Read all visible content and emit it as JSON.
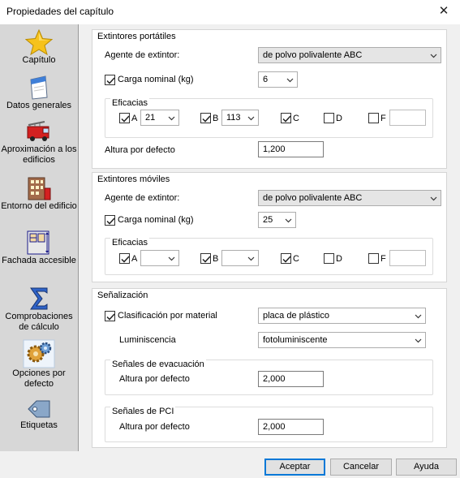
{
  "window": {
    "title": "Propiedades del capítulo",
    "close_glyph": "✕"
  },
  "sidebar": {
    "items": [
      {
        "label": "Capítulo",
        "icon": "star-icon"
      },
      {
        "label": "Datos generales",
        "icon": "document-icon"
      },
      {
        "label": "Aproximación a los edificios",
        "icon": "fire-truck-icon"
      },
      {
        "label": "Entorno del edificio",
        "icon": "building-icon"
      },
      {
        "label": "Fachada accesible",
        "icon": "facade-icon"
      },
      {
        "label": "Comprobaciones de cálculo",
        "icon": "sigma-icon"
      },
      {
        "label": "Opciones por defecto",
        "icon": "gears-icon"
      },
      {
        "label": "Etiquetas",
        "icon": "tag-icon"
      }
    ],
    "selected": "Opciones por defecto"
  },
  "portatiles": {
    "title": "Extintores portátiles",
    "agente_label": "Agente de extintor:",
    "agente_value": "de polvo polivalente ABC",
    "carga_label": "Carga nominal (kg)",
    "carga_checked": true,
    "carga_value": "6",
    "eficacias_title": "Eficacias",
    "a_label": "A",
    "a_checked": true,
    "a_value": "21",
    "b_label": "B",
    "b_checked": true,
    "b_value": "113",
    "c_label": "C",
    "c_checked": true,
    "d_label": "D",
    "d_checked": false,
    "f_label": "F",
    "f_checked": false,
    "f_value": "",
    "altura_label": "Altura por defecto",
    "altura_value": "1,200"
  },
  "moviles": {
    "title": "Extintores móviles",
    "agente_label": "Agente de extintor:",
    "agente_value": "de polvo polivalente ABC",
    "carga_label": "Carga nominal (kg)",
    "carga_checked": true,
    "carga_value": "25",
    "eficacias_title": "Eficacias",
    "a_label": "A",
    "a_checked": true,
    "a_value": "",
    "b_label": "B",
    "b_checked": true,
    "b_value": "",
    "c_label": "C",
    "c_checked": true,
    "d_label": "D",
    "d_checked": false,
    "f_label": "F",
    "f_checked": false,
    "f_value": ""
  },
  "senalizacion": {
    "title": "Señalización",
    "clasif_label": "Clasificación por material",
    "clasif_checked": true,
    "clasif_value": "placa de plástico",
    "lumin_label": "Luminiscencia",
    "lumin_value": "fotoluminiscente",
    "evac_title": "Señales de evacuación",
    "evac_altura_label": "Altura por defecto",
    "evac_altura_value": "2,000",
    "pci_title": "Señales de PCI",
    "pci_altura_label": "Altura por defecto",
    "pci_altura_value": "2,000"
  },
  "buttons": {
    "accept": "Aceptar",
    "cancel": "Cancelar",
    "help": "Ayuda"
  },
  "colors": {
    "accent": "#0078d7",
    "sidebar_bg": "#d7d7d7",
    "panel_bg": "#f0f0f0"
  }
}
